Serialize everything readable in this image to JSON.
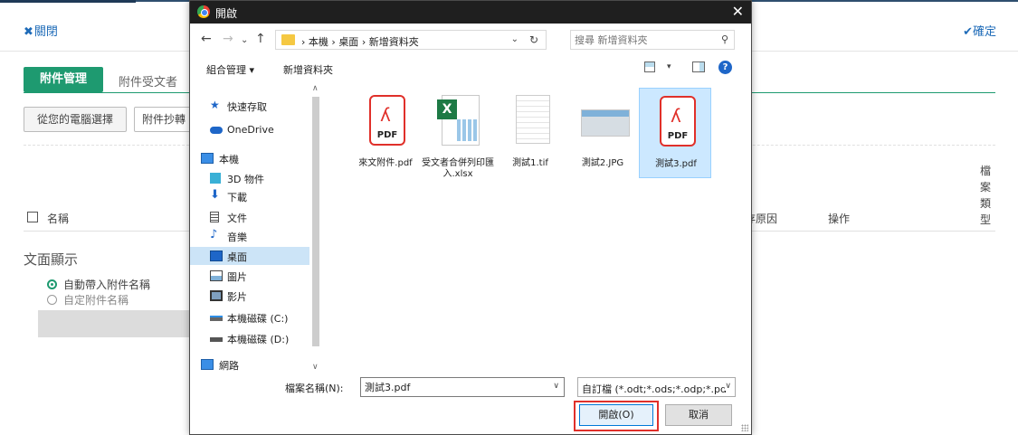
{
  "page": {
    "close_label": "關閉",
    "confirm_label": "確定",
    "tabs": [
      {
        "label": "附件管理",
        "active": true
      },
      {
        "label": "附件受文者"
      }
    ],
    "buttons": {
      "from_pc": "從您的電腦選擇",
      "cc": "附件抄轉"
    },
    "table_headers": {
      "name": "名稱",
      "reason": "存原因",
      "operation": "操作",
      "file_type": "檔案類型"
    },
    "section": {
      "title": "文面顯示",
      "options": [
        {
          "label": "自動帶入附件名稱",
          "selected": true
        },
        {
          "label": "自定附件名稱",
          "selected": false
        }
      ]
    },
    "colors": {
      "accent": "#1e9a70",
      "link": "#1e6bb8"
    }
  },
  "dialog": {
    "title": "開啟",
    "close_glyph": "✕",
    "breadcrumb": [
      "本機",
      "桌面",
      "新增資料夾"
    ],
    "search_placeholder": "搜尋 新增資料夾",
    "toolbar": {
      "organize": "組合管理 ▾",
      "new_folder": "新增資料夾",
      "help": "?"
    },
    "nav_items": [
      {
        "label": "快速存取",
        "icon": "star-icon"
      },
      {
        "label": "OneDrive",
        "icon": "cloud-icon"
      },
      {
        "label": "本機",
        "icon": "computer-icon"
      },
      {
        "label": "3D 物件",
        "icon": "cube-icon"
      },
      {
        "label": "下載",
        "icon": "download-icon"
      },
      {
        "label": "文件",
        "icon": "document-icon"
      },
      {
        "label": "音樂",
        "icon": "music-icon"
      },
      {
        "label": "桌面",
        "icon": "desktop-icon",
        "selected": true
      },
      {
        "label": "圖片",
        "icon": "pictures-icon"
      },
      {
        "label": "影片",
        "icon": "video-icon"
      },
      {
        "label": "本機磁碟 (C:)",
        "icon": "drive-c-icon"
      },
      {
        "label": "本機磁碟 (D:)",
        "icon": "drive-d-icon"
      },
      {
        "label": "網路",
        "icon": "network-icon"
      }
    ],
    "files": [
      {
        "name": "來文附件.pdf",
        "kind": "pdf"
      },
      {
        "name": "受文者合併列印匯入.xlsx",
        "kind": "xlsx"
      },
      {
        "name": "測試1.tif",
        "kind": "tif"
      },
      {
        "name": "測試2.JPG",
        "kind": "jpg"
      },
      {
        "name": "測試3.pdf",
        "kind": "pdf",
        "selected": true
      }
    ],
    "filename_label": "檔案名稱(N):",
    "filename_value": "測試3.pdf",
    "file_type_value": "自訂檔 (*.odt;*.ods;*.odp;*.pd",
    "open_button": "開啟(O)",
    "cancel_button": "取消",
    "pdf_glyph": "PDF",
    "xls_glyph": "X"
  }
}
